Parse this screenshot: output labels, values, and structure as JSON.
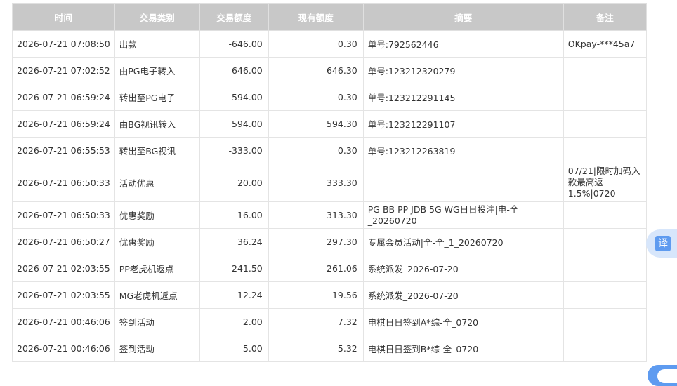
{
  "table": {
    "headers": [
      "时间",
      "交易类别",
      "交易额度",
      "现有额度",
      "摘要",
      "备注"
    ],
    "rows": [
      {
        "time": "2026-07-21 07:08:50",
        "type": "出款",
        "amount": "-646.00",
        "balance": "0.30",
        "summary": "单号:792562446",
        "note": "OKpay-***45a7"
      },
      {
        "time": "2026-07-21 07:02:52",
        "type": "由PG电子转入",
        "amount": "646.00",
        "balance": "646.30",
        "summary": "单号:123212320279",
        "note": ""
      },
      {
        "time": "2026-07-21 06:59:24",
        "type": "转出至PG电子",
        "amount": "-594.00",
        "balance": "0.30",
        "summary": "单号:123212291145",
        "note": ""
      },
      {
        "time": "2026-07-21 06:59:24",
        "type": "由BG视讯转入",
        "amount": "594.00",
        "balance": "594.30",
        "summary": "单号:123212291107",
        "note": ""
      },
      {
        "time": "2026-07-21 06:55:53",
        "type": "转出至BG视讯",
        "amount": "-333.00",
        "balance": "0.30",
        "summary": "单号:123212263819",
        "note": ""
      },
      {
        "time": "2026-07-21 06:50:33",
        "type": "活动优惠",
        "amount": "20.00",
        "balance": "333.30",
        "summary": "",
        "note": "07/21|限时加码入款最高返1.5%|0720"
      },
      {
        "time": "2026-07-21 06:50:33",
        "type": "优惠奖励",
        "amount": "16.00",
        "balance": "313.30",
        "summary": "PG BB PP JDB 5G WG日日投注|电-全_20260720",
        "note": ""
      },
      {
        "time": "2026-07-21 06:50:27",
        "type": "优惠奖励",
        "amount": "36.24",
        "balance": "297.30",
        "summary": "专属会员活动|全-全_1_20260720",
        "note": ""
      },
      {
        "time": "2026-07-21 02:03:55",
        "type": "PP老虎机返点",
        "amount": "241.50",
        "balance": "261.06",
        "summary": "系统派发_2026-07-20",
        "note": ""
      },
      {
        "time": "2026-07-21 02:03:55",
        "type": "MG老虎机返点",
        "amount": "12.24",
        "balance": "19.56",
        "summary": "系统派发_2026-07-20",
        "note": ""
      },
      {
        "time": "2026-07-21 00:46:06",
        "type": "签到活动",
        "amount": "2.00",
        "balance": "7.32",
        "summary": "电棋日日签到A*综-全_0720",
        "note": ""
      },
      {
        "time": "2026-07-21 00:46:06",
        "type": "签到活动",
        "amount": "5.00",
        "balance": "5.32",
        "summary": "电棋日日签到B*综-全_0720",
        "note": ""
      }
    ]
  },
  "translate_button": {
    "label": "译",
    "color": "#5e9bf0"
  },
  "colors": {
    "header_bg": "#c8c8c8",
    "border": "#e4e4e4"
  }
}
